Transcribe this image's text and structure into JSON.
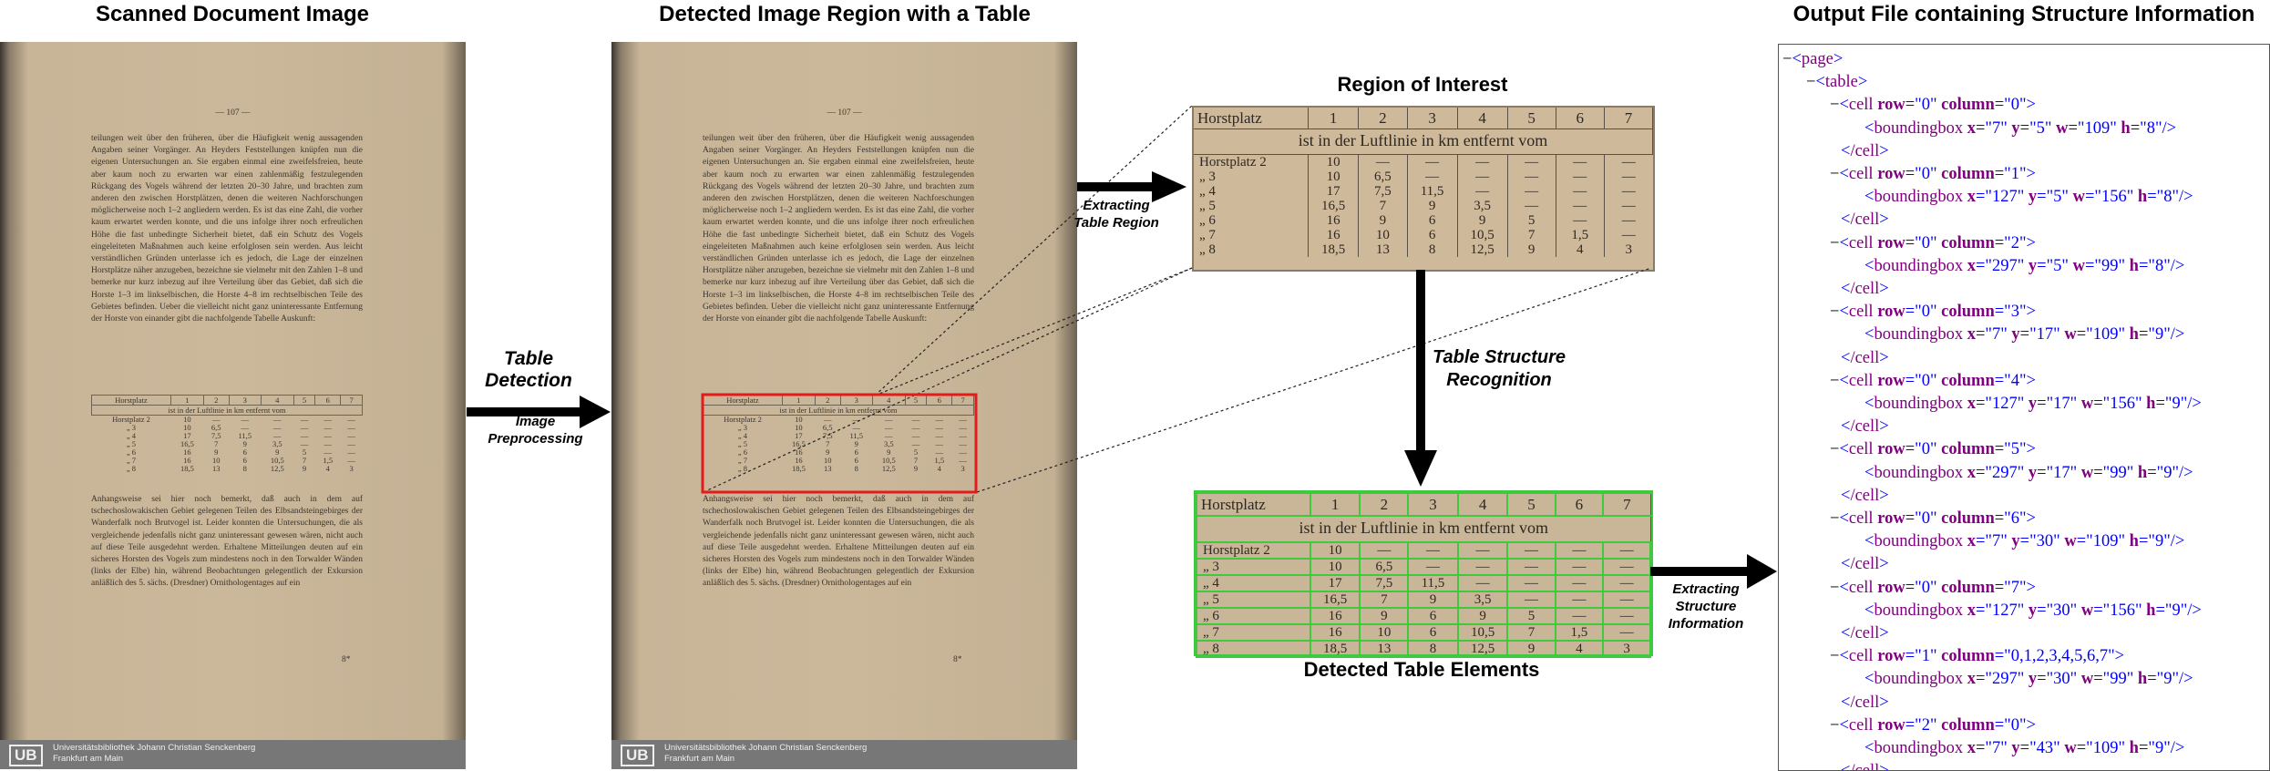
{
  "titles": {
    "scanned": "Scanned Document Image",
    "detected": "Detected Image Region with a Table",
    "roi": "Region of Interest",
    "elements": "Detected Table Elements",
    "output": "Output File containing Structure Information"
  },
  "steps": {
    "detection": "Table\nDetection",
    "preprocessing": "Image\nPreprocessing",
    "extracting_region": "Extracting\nTable Region",
    "structure": "Table Structure\nRecognition",
    "extracting_info": "Extracting\nStructure\nInformation"
  },
  "scan": {
    "page_number": "— 107 —",
    "footer_logo": "UB",
    "footer_line1": "Universitätsbibliothek Johann Christian Senckenberg",
    "footer_line2": "Frankfurt am Main",
    "page_mark": "8*"
  },
  "table": {
    "header": [
      "Horstplatz",
      "1",
      "2",
      "3",
      "4",
      "5",
      "6",
      "7"
    ],
    "subheader": "ist in der Luftlinie in km entfernt vom",
    "rows": [
      [
        "Horstplatz 2",
        "10",
        "—",
        "—",
        "—",
        "—",
        "—",
        "—"
      ],
      [
        "„       3",
        "10",
        "6,5",
        "—",
        "—",
        "—",
        "—",
        "—"
      ],
      [
        "„       4",
        "17",
        "7,5",
        "11,5",
        "—",
        "—",
        "—",
        "—"
      ],
      [
        "„       5",
        "16,5",
        "7",
        "9",
        "3,5",
        "—",
        "—",
        "—"
      ],
      [
        "„       6",
        "16",
        "9",
        "6",
        "9",
        "5",
        "—",
        "—"
      ],
      [
        "„       7",
        "16",
        "10",
        "6",
        "10,5",
        "7",
        "1,5",
        "—"
      ],
      [
        "„       8",
        "18,5",
        "13",
        "8",
        "12,5",
        "9",
        "4",
        "3"
      ]
    ]
  },
  "xml": [
    {
      "indent": 0,
      "prefix": "−",
      "tag": "page",
      "attrs": [],
      "close": false
    },
    {
      "indent": 1,
      "prefix": "−",
      "tag": "table",
      "attrs": [],
      "close": false
    },
    {
      "indent": 2,
      "prefix": "−",
      "tag": "cell",
      "attrs": [
        [
          "row",
          "0"
        ],
        [
          "column",
          "0"
        ]
      ],
      "close": false
    },
    {
      "indent": 3,
      "prefix": "",
      "tag": "boundingbox",
      "attrs": [
        [
          "x",
          "7"
        ],
        [
          "y",
          "5"
        ],
        [
          "w",
          "109"
        ],
        [
          "h",
          "8"
        ]
      ],
      "close": true
    },
    {
      "indent": 2,
      "prefix": "",
      "tag": "/cell",
      "attrs": [],
      "close": false
    },
    {
      "indent": 2,
      "prefix": "−",
      "tag": "cell",
      "attrs": [
        [
          "row",
          "0"
        ],
        [
          "column",
          "1"
        ]
      ],
      "close": false
    },
    {
      "indent": 3,
      "prefix": "",
      "tag": "boundingbox",
      "attrs": [
        [
          "x",
          "127"
        ],
        [
          "y",
          "5"
        ],
        [
          "w",
          "156"
        ],
        [
          "h",
          "8"
        ]
      ],
      "close": true
    },
    {
      "indent": 2,
      "prefix": "",
      "tag": "/cell",
      "attrs": [],
      "close": false
    },
    {
      "indent": 2,
      "prefix": "−",
      "tag": "cell",
      "attrs": [
        [
          "row",
          "0"
        ],
        [
          "column",
          "2"
        ]
      ],
      "close": false
    },
    {
      "indent": 3,
      "prefix": "",
      "tag": "boundingbox",
      "attrs": [
        [
          "x",
          "297"
        ],
        [
          "y",
          "5"
        ],
        [
          "w",
          "99"
        ],
        [
          "h",
          "8"
        ]
      ],
      "close": true
    },
    {
      "indent": 2,
      "prefix": "",
      "tag": "/cell",
      "attrs": [],
      "close": false
    },
    {
      "indent": 2,
      "prefix": "−",
      "tag": "cell",
      "attrs": [
        [
          "row",
          "0"
        ],
        [
          "column",
          "3"
        ]
      ],
      "close": false
    },
    {
      "indent": 3,
      "prefix": "",
      "tag": "boundingbox",
      "attrs": [
        [
          "x",
          "7"
        ],
        [
          "y",
          "17"
        ],
        [
          "w",
          "109"
        ],
        [
          "h",
          "9"
        ]
      ],
      "close": true
    },
    {
      "indent": 2,
      "prefix": "",
      "tag": "/cell",
      "attrs": [],
      "close": false
    },
    {
      "indent": 2,
      "prefix": "−",
      "tag": "cell",
      "attrs": [
        [
          "row",
          "0"
        ],
        [
          "column",
          "4"
        ]
      ],
      "close": false
    },
    {
      "indent": 3,
      "prefix": "",
      "tag": "boundingbox",
      "attrs": [
        [
          "x",
          "127"
        ],
        [
          "y",
          "17"
        ],
        [
          "w",
          "156"
        ],
        [
          "h",
          "9"
        ]
      ],
      "close": true
    },
    {
      "indent": 2,
      "prefix": "",
      "tag": "/cell",
      "attrs": [],
      "close": false
    },
    {
      "indent": 2,
      "prefix": "−",
      "tag": "cell",
      "attrs": [
        [
          "row",
          "0"
        ],
        [
          "column",
          "5"
        ]
      ],
      "close": false
    },
    {
      "indent": 3,
      "prefix": "",
      "tag": "boundingbox",
      "attrs": [
        [
          "x",
          "297"
        ],
        [
          "y",
          "17"
        ],
        [
          "w",
          "99"
        ],
        [
          "h",
          "9"
        ]
      ],
      "close": true
    },
    {
      "indent": 2,
      "prefix": "",
      "tag": "/cell",
      "attrs": [],
      "close": false
    },
    {
      "indent": 2,
      "prefix": "−",
      "tag": "cell",
      "attrs": [
        [
          "row",
          "0"
        ],
        [
          "column",
          "6"
        ]
      ],
      "close": false
    },
    {
      "indent": 3,
      "prefix": "",
      "tag": "boundingbox",
      "attrs": [
        [
          "x",
          "7"
        ],
        [
          "y",
          "30"
        ],
        [
          "w",
          "109"
        ],
        [
          "h",
          "9"
        ]
      ],
      "close": true
    },
    {
      "indent": 2,
      "prefix": "",
      "tag": "/cell",
      "attrs": [],
      "close": false
    },
    {
      "indent": 2,
      "prefix": "−",
      "tag": "cell",
      "attrs": [
        [
          "row",
          "0"
        ],
        [
          "column",
          "7"
        ]
      ],
      "close": false
    },
    {
      "indent": 3,
      "prefix": "",
      "tag": "boundingbox",
      "attrs": [
        [
          "x",
          "127"
        ],
        [
          "y",
          "30"
        ],
        [
          "w",
          "156"
        ],
        [
          "h",
          "9"
        ]
      ],
      "close": true
    },
    {
      "indent": 2,
      "prefix": "",
      "tag": "/cell",
      "attrs": [],
      "close": false
    },
    {
      "indent": 2,
      "prefix": "−",
      "tag": "cell",
      "attrs": [
        [
          "row",
          "1"
        ],
        [
          "column",
          "0,1,2,3,4,5,6,7"
        ]
      ],
      "close": false
    },
    {
      "indent": 3,
      "prefix": "",
      "tag": "boundingbox",
      "attrs": [
        [
          "x",
          "297"
        ],
        [
          "y",
          "30"
        ],
        [
          "w",
          "99"
        ],
        [
          "h",
          "9"
        ]
      ],
      "close": true
    },
    {
      "indent": 2,
      "prefix": "",
      "tag": "/cell",
      "attrs": [],
      "close": false
    },
    {
      "indent": 2,
      "prefix": "−",
      "tag": "cell",
      "attrs": [
        [
          "row",
          "2"
        ],
        [
          "column",
          "0"
        ]
      ],
      "close": false
    },
    {
      "indent": 3,
      "prefix": "",
      "tag": "boundingbox",
      "attrs": [
        [
          "x",
          "7"
        ],
        [
          "y",
          "43"
        ],
        [
          "w",
          "109"
        ],
        [
          "h",
          "9"
        ]
      ],
      "close": true
    },
    {
      "indent": 2,
      "prefix": "",
      "tag": "/cell",
      "attrs": [],
      "close": false
    }
  ]
}
